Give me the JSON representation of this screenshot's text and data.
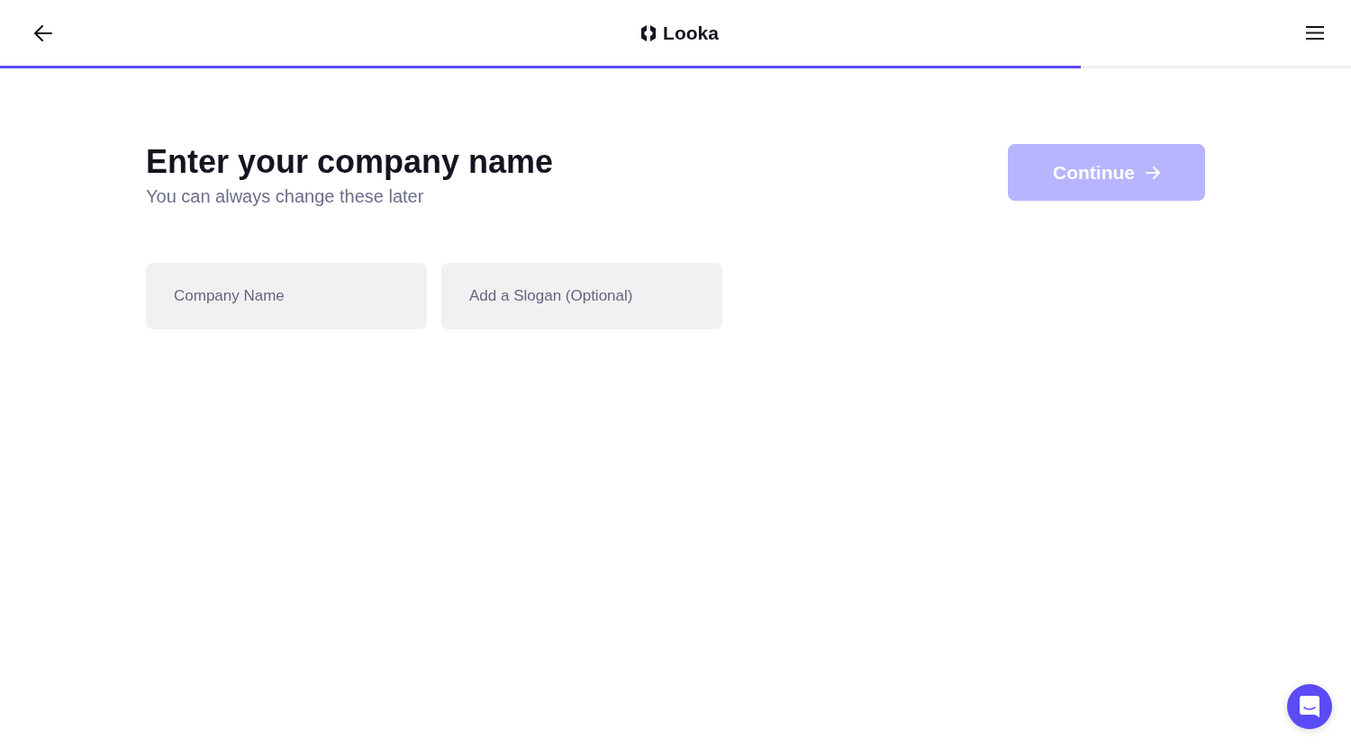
{
  "header": {
    "logo": "Looka",
    "progress": {
      "level": 0.8
    }
  },
  "heading": "Enter your company name",
  "subheading": "You can always change these later",
  "continue_button": {
    "label": "Continue",
    "disabled": true
  },
  "fields": [
    {
      "placeholder": "Company Name"
    },
    {
      "placeholder": "Add a Slogan (Optional)"
    }
  ]
}
